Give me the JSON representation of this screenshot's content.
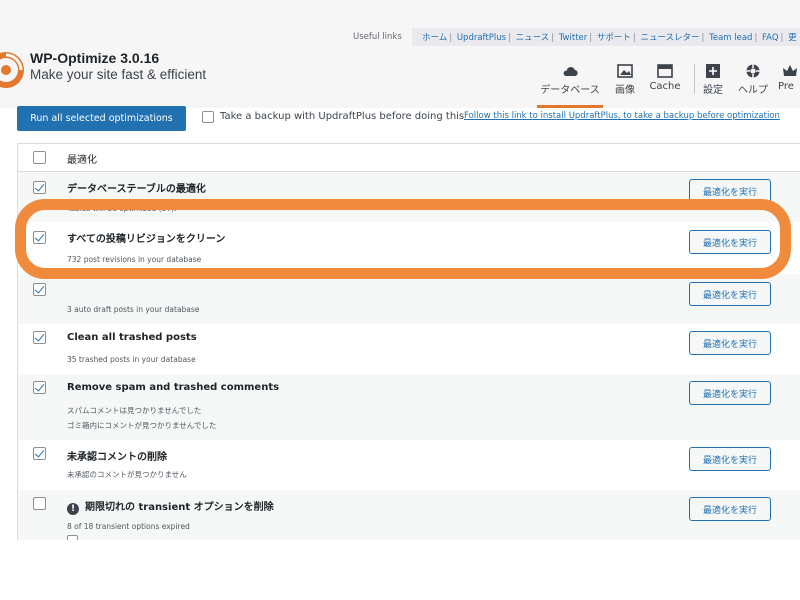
{
  "header": {
    "title": "WP-Optimize 3.0.16",
    "subtitle": "Make your site fast & efficient",
    "useful_label": "Useful links",
    "useful_links": [
      "ホーム",
      "UpdraftPlus",
      "ニュース",
      "Twitter",
      "サポート",
      "ニュースレター",
      "Team lead",
      "FAQ",
      "更"
    ],
    "tabs": [
      {
        "label": "データベース",
        "icon": "cloud-icon",
        "active": true
      },
      {
        "label": "画像",
        "icon": "image-icon"
      },
      {
        "label": "Cache",
        "icon": "cache-icon"
      },
      {
        "label": "設定",
        "icon": "settings-icon"
      },
      {
        "label": "ヘルプ",
        "icon": "help-icon"
      },
      {
        "label": "Pre",
        "icon": "premium-icon"
      }
    ]
  },
  "toolbar": {
    "run_all_label": "Run all selected optimizations",
    "backup_label": "Take a backup with UpdraftPlus before doing this",
    "backup_link": "Follow this link to install UpdraftPlus, to take a backup before optimization"
  },
  "table": {
    "header_label": "最適化",
    "rows": [
      {
        "title": "データベーステーブルの最適化",
        "desc": [
          "Tables will be optimized (37)."
        ],
        "checked": true,
        "button": "最適化を実行"
      },
      {
        "title": "すべての投稿リビジョンをクリーン",
        "desc": [
          "732 post revisions in your database"
        ],
        "checked": true,
        "button": "最適化を実行"
      },
      {
        "title": "",
        "desc": [
          "3 auto draft posts in your database"
        ],
        "checked": true,
        "button": "最適化を実行"
      },
      {
        "title": "Clean all trashed posts",
        "desc": [
          "35 trashed posts in your database"
        ],
        "checked": true,
        "button": "最適化を実行"
      },
      {
        "title": "Remove spam and trashed comments",
        "desc": [
          "スパムコメントは見つかりませんでした",
          "ゴミ箱内にコメントが見つかりませんでした"
        ],
        "checked": true,
        "button": "最適化を実行"
      },
      {
        "title": "未承認コメントの削除",
        "desc": [
          "未承認のコメントが見つかりません"
        ],
        "checked": true,
        "button": "最適化を実行"
      },
      {
        "title": "期限切れの transient オプションを削除",
        "desc": [
          "8 of 18 transient options expired"
        ],
        "checked": false,
        "warning": true,
        "button": "最適化を実行"
      }
    ]
  },
  "colors": {
    "accent": "#2271b1",
    "highlight": "#f08a3c",
    "brand": "#e27730"
  }
}
